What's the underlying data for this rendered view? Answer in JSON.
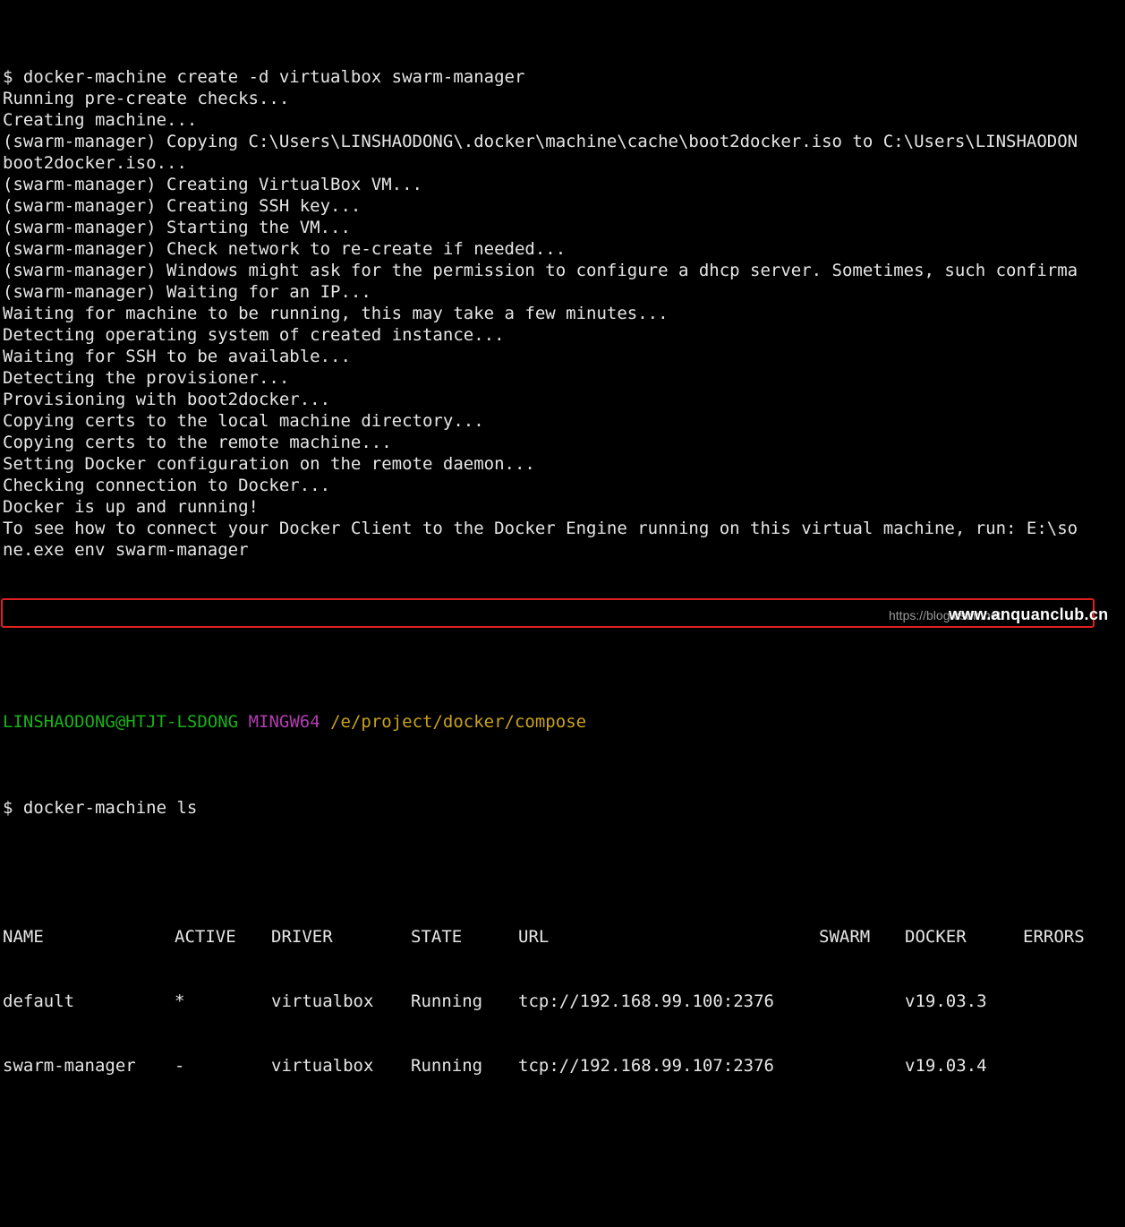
{
  "terminal": {
    "create_output": [
      "$ docker-machine create -d virtualbox swarm-manager",
      "Running pre-create checks...",
      "Creating machine...",
      "(swarm-manager) Copying C:\\Users\\LINSHAODONG\\.docker\\machine\\cache\\boot2docker.iso to C:\\Users\\LINSHAODON",
      "boot2docker.iso...",
      "(swarm-manager) Creating VirtualBox VM...",
      "(swarm-manager) Creating SSH key...",
      "(swarm-manager) Starting the VM...",
      "(swarm-manager) Check network to re-create if needed...",
      "(swarm-manager) Windows might ask for the permission to configure a dhcp server. Sometimes, such confirma",
      "(swarm-manager) Waiting for an IP...",
      "Waiting for machine to be running, this may take a few minutes...",
      "Detecting operating system of created instance...",
      "Waiting for SSH to be available...",
      "Detecting the provisioner...",
      "Provisioning with boot2docker...",
      "Copying certs to the local machine directory...",
      "Copying certs to the remote machine...",
      "Setting Docker configuration on the remote daemon...",
      "Checking connection to Docker...",
      "Docker is up and running!",
      "To see how to connect your Docker Client to the Docker Engine running on this virtual machine, run: E:\\so",
      "ne.exe env swarm-manager"
    ],
    "prompt": {
      "user_host": "LINSHAODONG@HTJT-LSDONG",
      "system": "MINGW64",
      "path": "/e/project/docker/compose"
    },
    "ls_command": "$ docker-machine ls",
    "ls_table": {
      "headers": [
        "NAME",
        "ACTIVE",
        "DRIVER",
        "STATE",
        "URL",
        "SWARM",
        "DOCKER",
        "ERRORS"
      ],
      "rows": [
        [
          "default",
          "*",
          "virtualbox",
          "Running",
          "tcp://192.168.99.100:2376",
          "",
          "v19.03.3",
          ""
        ],
        [
          "swarm-manager",
          "-",
          "virtualbox",
          "Running",
          "tcp://192.168.99.107:2376",
          "",
          "v19.03.4",
          ""
        ]
      ]
    }
  },
  "watermark": {
    "faint_text": "https://blog.csdn.net/",
    "text": "www.anquanclub.cn"
  },
  "colors": {
    "background": "#000000",
    "text": "#e6e6e6",
    "prompt_user": "#18b218",
    "prompt_system": "#b23cb2",
    "prompt_path": "#c9a21c",
    "highlight_border": "#e0201e"
  }
}
